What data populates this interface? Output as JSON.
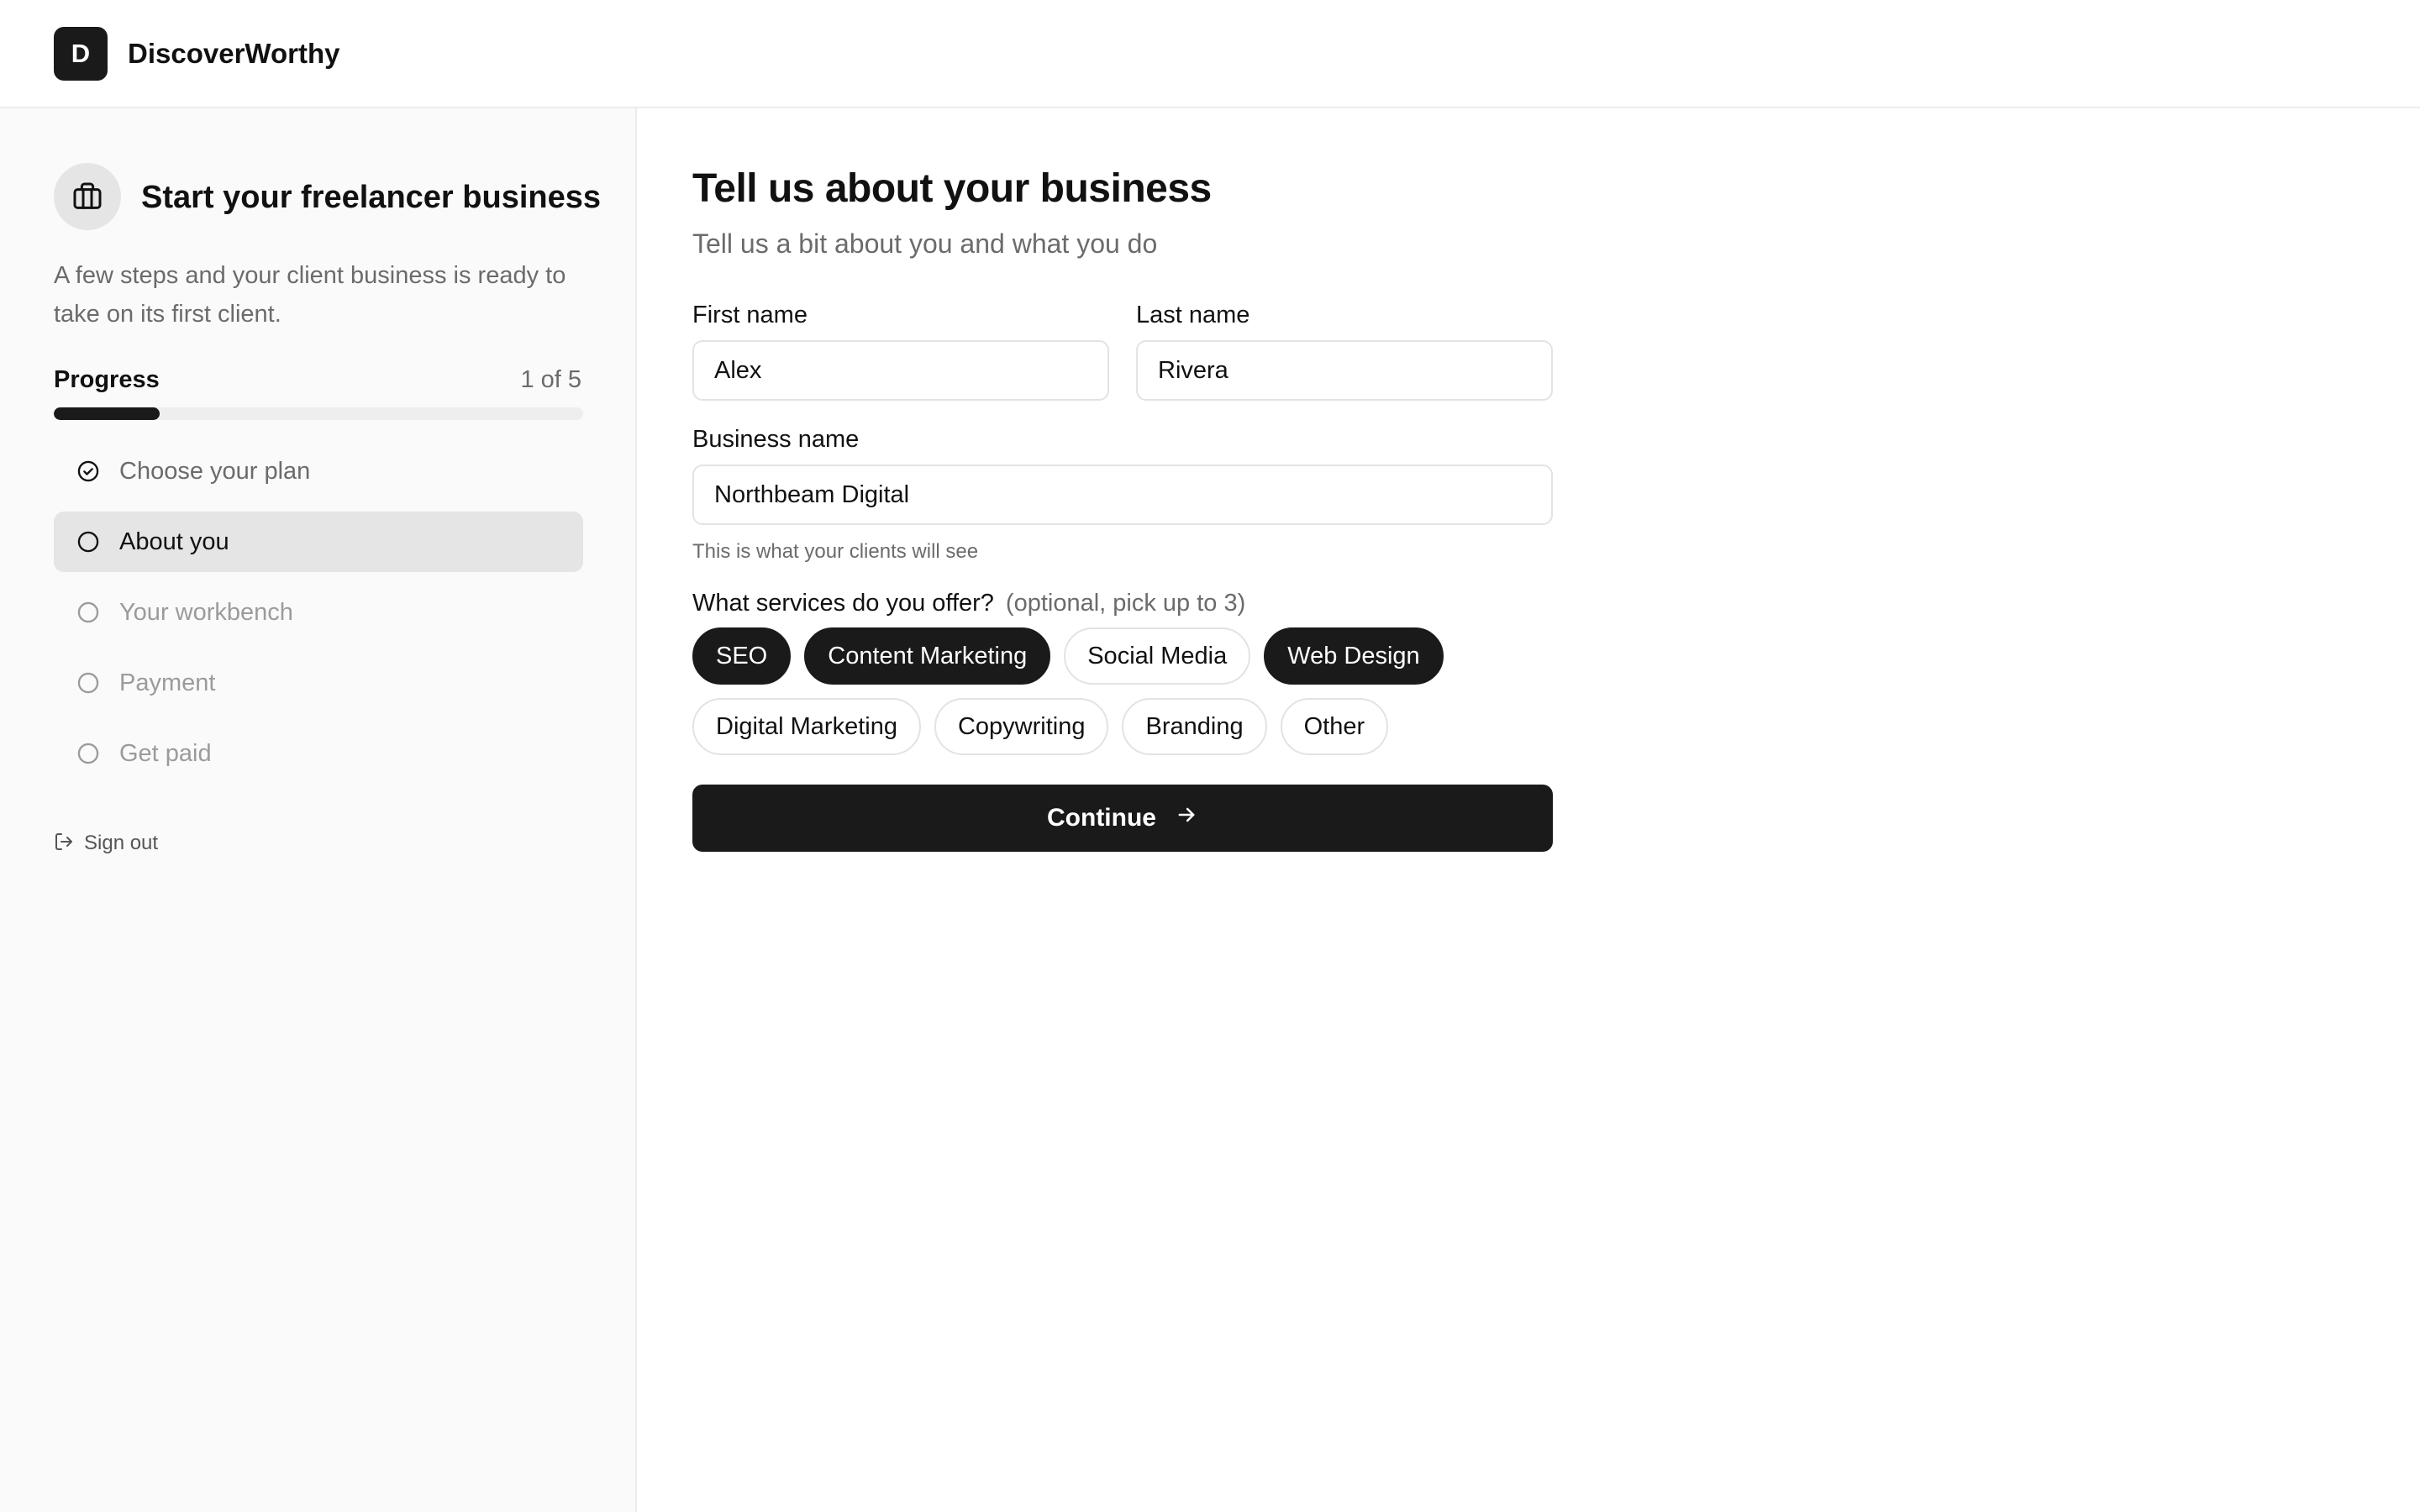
{
  "app": {
    "logo_letter": "D",
    "name": "DiscoverWorthy"
  },
  "sidebar": {
    "title": "Start your freelancer business",
    "description": "A few steps and your client business is ready to take on its first client.",
    "progress_label": "Progress",
    "progress_count": "1 of 5",
    "progress_fraction": 0.2,
    "steps": [
      {
        "label": "Choose your plan",
        "status": "done"
      },
      {
        "label": "About you",
        "status": "active"
      },
      {
        "label": "Your workbench",
        "status": "todo"
      },
      {
        "label": "Payment",
        "status": "todo"
      },
      {
        "label": "Get paid",
        "status": "todo"
      }
    ],
    "signout_label": "Sign out"
  },
  "form": {
    "title": "Tell us about your business",
    "subtitle": "Tell us a bit about you and what you do",
    "first_name_label": "First name",
    "first_name_value": "Alex",
    "last_name_label": "Last name",
    "last_name_value": "Rivera",
    "business_name_label": "Business name",
    "business_name_value": "Northbeam Digital",
    "business_name_hint": "This is what your clients will see",
    "services_label": "What services do you offer?",
    "services_optional": "(optional, pick up to 3)",
    "services": [
      {
        "label": "SEO",
        "selected": true
      },
      {
        "label": "Content Marketing",
        "selected": true
      },
      {
        "label": "Social Media",
        "selected": false
      },
      {
        "label": "Web Design",
        "selected": true
      },
      {
        "label": "Digital Marketing",
        "selected": false
      },
      {
        "label": "Copywriting",
        "selected": false
      },
      {
        "label": "Branding",
        "selected": false
      },
      {
        "label": "Other",
        "selected": false
      }
    ],
    "continue_label": "Continue"
  },
  "icons": {
    "brand": "briefcase-icon",
    "step_done": "check-circle-icon",
    "step_pending": "circle-icon",
    "signout": "log-out-icon",
    "continue": "arrow-right-icon"
  },
  "colors": {
    "accent": "#1a1a1a",
    "muted_text": "#6b6b6b",
    "sidebar_bg": "#fafafa",
    "active_step_bg": "#e5e5e5"
  }
}
